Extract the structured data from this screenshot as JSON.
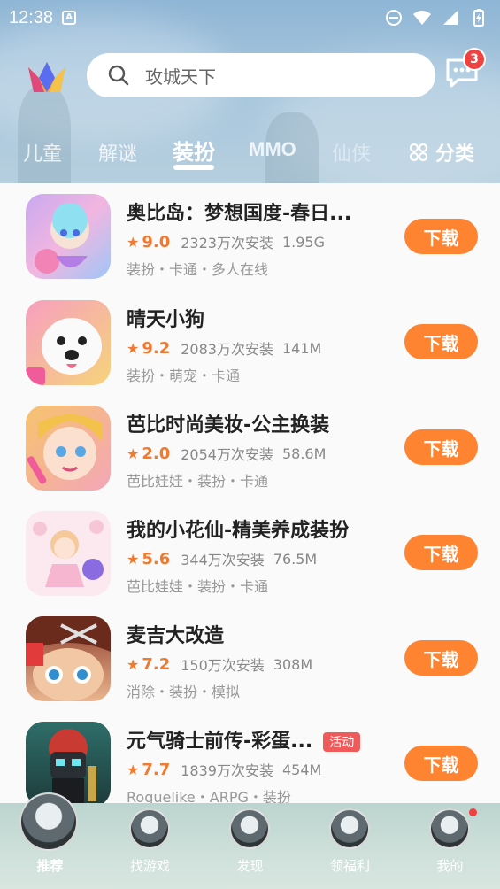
{
  "status_bar": {
    "time": "12:38"
  },
  "search": {
    "placeholder": "攻城天下"
  },
  "messages": {
    "badge_count": "3"
  },
  "tabs": [
    {
      "label": "儿童",
      "state": "normal"
    },
    {
      "label": "解谜",
      "state": "normal"
    },
    {
      "label": "装扮",
      "state": "active"
    },
    {
      "label": "MMO",
      "state": "normal"
    },
    {
      "label": "仙侠",
      "state": "faded"
    }
  ],
  "category_label": "分类",
  "download_label": "下载",
  "apps": [
    {
      "title": "奥比岛：梦想国度-春日...",
      "rating": "9.0",
      "installs": "2323万次安装",
      "size": "1.95G",
      "tags": "装扮・卡通・多人在线",
      "badge": ""
    },
    {
      "title": "晴天小狗",
      "rating": "9.2",
      "installs": "2083万次安装",
      "size": "141M",
      "tags": "装扮・萌宠・卡通",
      "badge": ""
    },
    {
      "title": "芭比时尚美妆-公主换装",
      "rating": "2.0",
      "installs": "2054万次安装",
      "size": "58.6M",
      "tags": "芭比娃娃・装扮・卡通",
      "badge": ""
    },
    {
      "title": "我的小花仙-精美养成装扮",
      "rating": "5.6",
      "installs": "344万次安装",
      "size": "76.5M",
      "tags": "芭比娃娃・装扮・卡通",
      "badge": ""
    },
    {
      "title": "麦吉大改造",
      "rating": "7.2",
      "installs": "150万次安装",
      "size": "308M",
      "tags": "消除・装扮・模拟",
      "badge": ""
    },
    {
      "title": "元气骑士前传-彩蛋...",
      "rating": "7.7",
      "installs": "1839万次安装",
      "size": "454M",
      "tags": "Roguelike・ARPG・装扮",
      "badge": "活动"
    }
  ],
  "bottom_nav": [
    {
      "label": "推荐",
      "active": true
    },
    {
      "label": "找游戏",
      "active": false
    },
    {
      "label": "发现",
      "active": false
    },
    {
      "label": "领福利",
      "active": false
    },
    {
      "label": "我的",
      "active": false
    }
  ],
  "colors": {
    "accent": "#ff8431",
    "badge": "#f04141"
  }
}
